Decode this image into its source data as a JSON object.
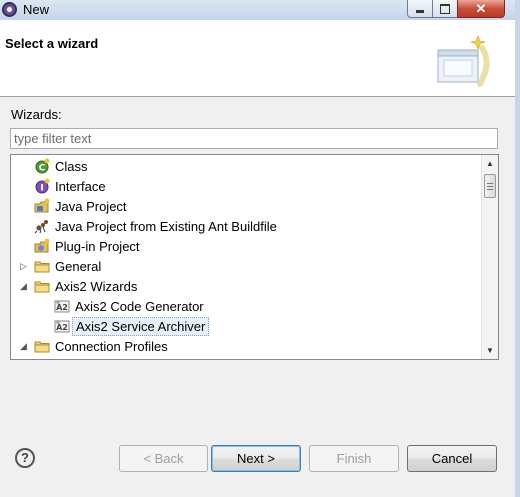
{
  "window": {
    "title": "New"
  },
  "banner": {
    "title": "Select a wizard"
  },
  "wizards": {
    "label": "Wizards:",
    "filter_placeholder": "type filter text",
    "items": [
      {
        "label": "Class",
        "icon": "class-icon",
        "level": 1,
        "twisty": ""
      },
      {
        "label": "Interface",
        "icon": "interface-icon",
        "level": 1,
        "twisty": ""
      },
      {
        "label": "Java Project",
        "icon": "java-project-icon",
        "level": 1,
        "twisty": ""
      },
      {
        "label": "Java Project from Existing Ant Buildfile",
        "icon": "ant-icon",
        "level": 1,
        "twisty": ""
      },
      {
        "label": "Plug-in Project",
        "icon": "plugin-project-icon",
        "level": 1,
        "twisty": ""
      },
      {
        "label": "General",
        "icon": "folder-icon",
        "level": 1,
        "twisty": "collapsed"
      },
      {
        "label": "Axis2 Wizards",
        "icon": "folder-icon",
        "level": 1,
        "twisty": "expanded"
      },
      {
        "label": "Axis2 Code Generator",
        "icon": "axis2-icon",
        "level": 2,
        "twisty": ""
      },
      {
        "label": "Axis2 Service Archiver",
        "icon": "axis2-icon",
        "level": 2,
        "twisty": "",
        "selected": true
      },
      {
        "label": "Connection Profiles",
        "icon": "folder-icon",
        "level": 1,
        "twisty": "expanded"
      }
    ]
  },
  "buttons": {
    "back": "< Back",
    "next": "Next >",
    "finish": "Finish",
    "cancel": "Cancel",
    "help": "?"
  },
  "colors": {
    "selection_bg": "#e8f1fb",
    "selection_border": "#7da2ce",
    "folder": "#e8c15c"
  }
}
